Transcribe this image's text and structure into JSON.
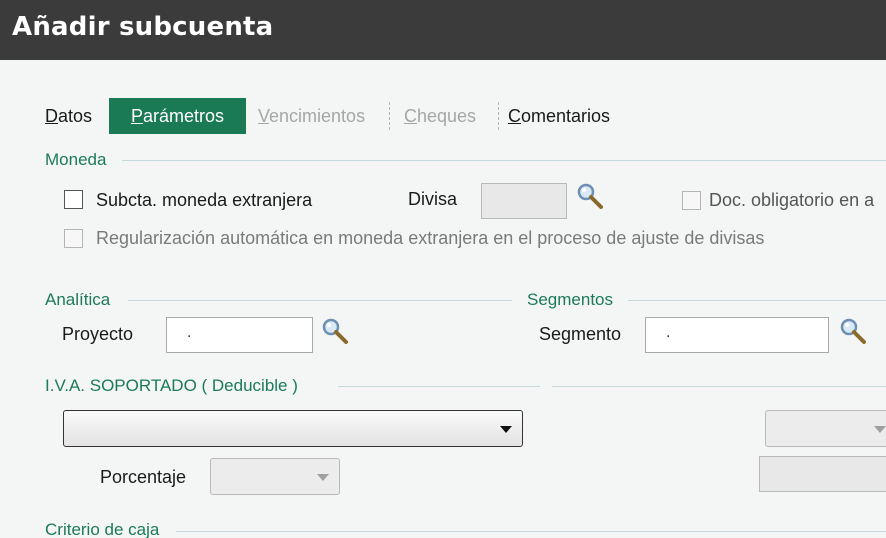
{
  "window": {
    "title": "Añadir subcuenta"
  },
  "tabs": [
    {
      "first": "D",
      "rest": "atos"
    },
    {
      "first": "P",
      "rest": "arámetros"
    },
    {
      "first": "V",
      "rest": "encimientos"
    },
    {
      "first": "C",
      "rest": "heques"
    },
    {
      "first": "C",
      "rest": "omentarios"
    }
  ],
  "moneda": {
    "section": "Moneda",
    "subcta_label": "Subcta. moneda extranjera",
    "divisa_label": "Divisa",
    "doc_label": "Doc. obligatorio en a",
    "regularizacion_label": "Regularización automática en moneda extranjera en el proceso de ajuste de divisas"
  },
  "analitica": {
    "section": "Analítica",
    "proyecto_label": "Proyecto",
    "proyecto_value": "."
  },
  "segmentos": {
    "section": "Segmentos",
    "segmento_label": "Segmento",
    "segmento_value": "."
  },
  "iva": {
    "section": "I.V.A. SOPORTADO ( Deducible )",
    "porcentaje_label": "Porcentaje"
  },
  "criterio": {
    "section": "Criterio de caja"
  },
  "icons": {
    "search": "search-icon",
    "dropdown": "chevron-down-icon"
  }
}
